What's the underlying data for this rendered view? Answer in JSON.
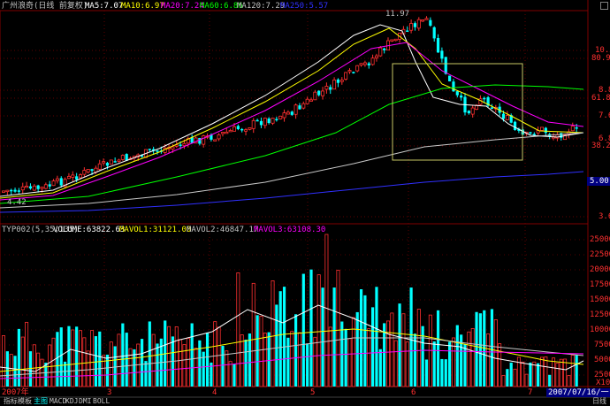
{
  "price_panel": {
    "title": "广州浪奇(日线 前复权)",
    "ma_legend": [
      {
        "label": "MA5:7.07",
        "color": "#ffffff"
      },
      {
        "label": "MA10:6.97",
        "color": "#ffff00"
      },
      {
        "label": "MA20:7.24",
        "color": "#ff00ff"
      },
      {
        "label": "MA60:6.86",
        "color": "#00ff00"
      },
      {
        "label": "MA120:7.29",
        "color": "#c0c0c0"
      },
      {
        "label": "MA250:5.57",
        "color": "#3030ff"
      }
    ],
    "high_marker": "11.97",
    "low_marker": "4.42",
    "right_axis": [
      "10.32",
      "80.9%",
      "8.81",
      "61.8%",
      "7.63",
      "6.82",
      "38.2%",
      "5.00",
      "3.69"
    ]
  },
  "volume_panel": {
    "legend": [
      {
        "label": "TYP002(5,35,135)",
        "color": "#c0c0c0"
      },
      {
        "label": "VOLUME:63822.63",
        "color": "#ffffff"
      },
      {
        "label": "MAVOL1:31121.00",
        "color": "#ffff00"
      },
      {
        "label": "MAVOL2:46847.17",
        "color": "#c0c0c0"
      },
      {
        "label": "MAVOL3:63108.30",
        "color": "#ff00ff"
      }
    ],
    "right_axis": [
      "25000",
      "22500",
      "20000",
      "17500",
      "15000",
      "12500",
      "10000",
      "7500",
      "5000",
      "2500",
      "X10"
    ]
  },
  "time_axis": {
    "labels": [
      "2007年",
      "3",
      "4",
      "5",
      "6",
      "7"
    ],
    "current_date": "2007/07/16/一"
  },
  "bottom_tabs": [
    "指标",
    "模板",
    "主图",
    "MACD",
    "KDJ",
    "DMI",
    "BOLL"
  ],
  "bottom_right": "日线",
  "colors": {
    "up": "#ff3030",
    "down": "#00ffff",
    "grid": "#800000",
    "box": "#c8c864"
  }
}
